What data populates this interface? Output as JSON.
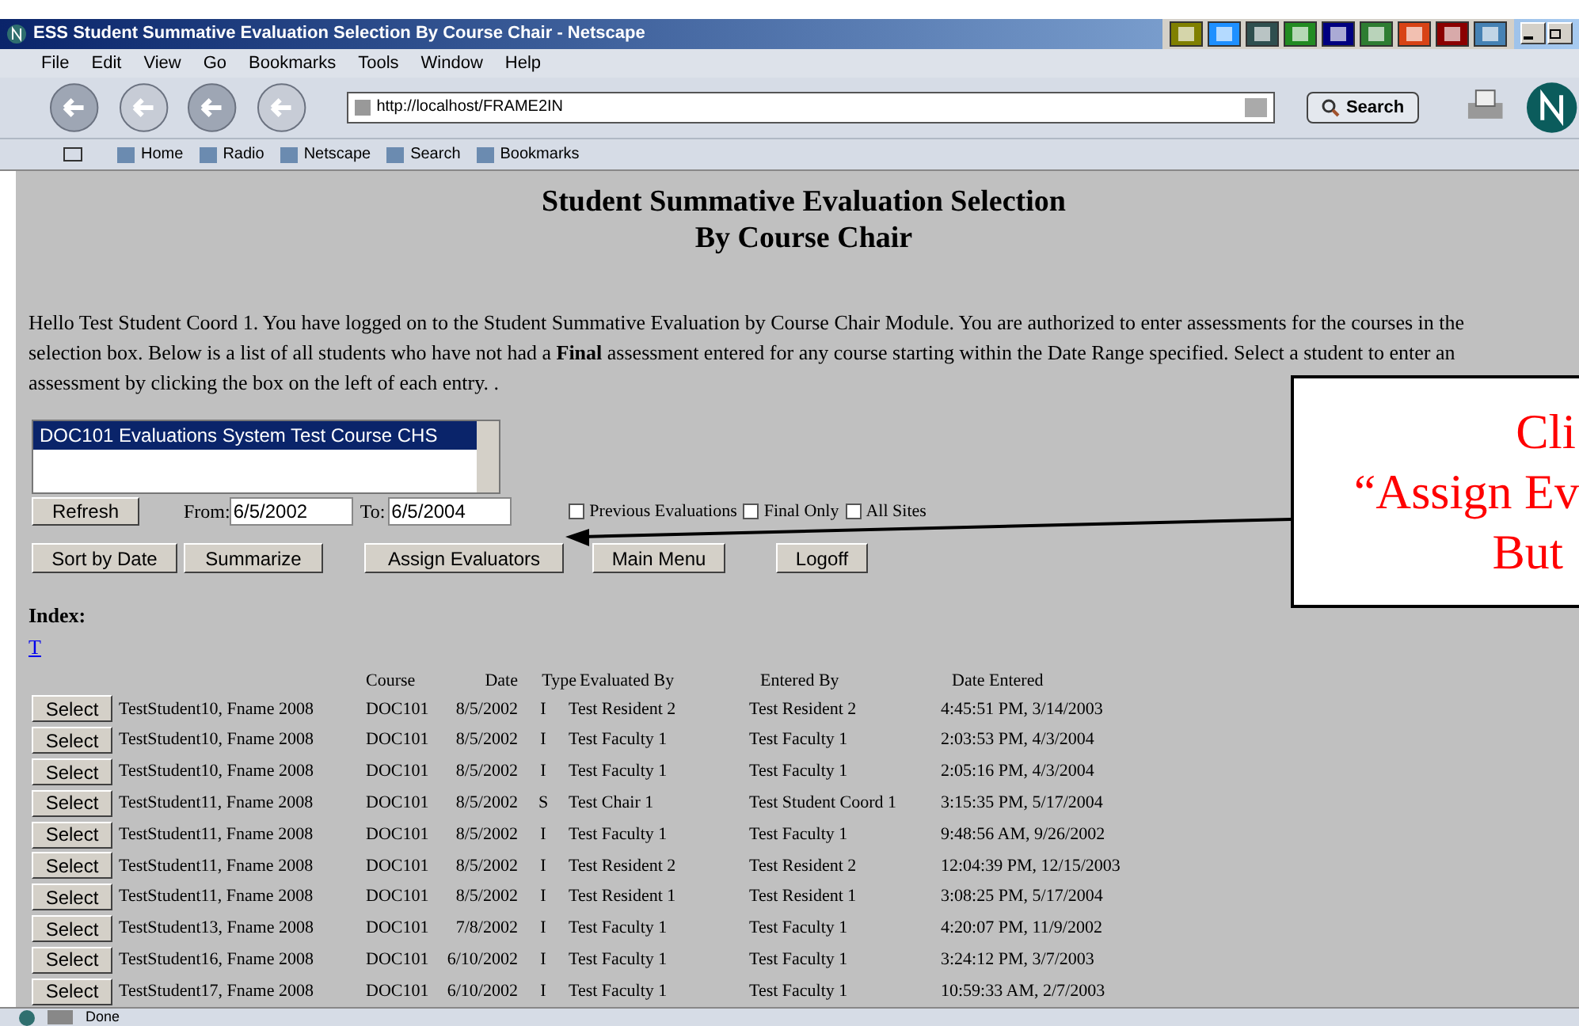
{
  "window": {
    "title": "ESS Student Summative Evaluation Selection By Course Chair - Netscape"
  },
  "menu": [
    "File",
    "Edit",
    "View",
    "Go",
    "Bookmarks",
    "Tools",
    "Window",
    "Help"
  ],
  "address": {
    "value": "http://localhost/FRAME2IN"
  },
  "search_button": "Search",
  "personal_toolbar": [
    "Home",
    "Radio",
    "Netscape",
    "Search",
    "Bookmarks"
  ],
  "heading": [
    "Student Summative Evaluation Selection",
    "By Course Chair"
  ],
  "intro": "Hello Test Student Coord 1. You have logged on to the Student Summative Evaluation by Course Chair Module. You are authorized to enter assessments for the courses in the selection box. Below is a list of all students who have not had a **Final** assessment entered for any course starting within the Date Range specified. Select a student to enter an assessment by clicking the box on the left of each entry. .",
  "course_list": [
    {
      "label": "DOC101 Evaluations System Test Course CHS",
      "selected": true
    }
  ],
  "refresh": "Refresh",
  "from": {
    "label": "From:",
    "value": "6/5/2002"
  },
  "to": {
    "label": "To:",
    "value": "6/5/2004"
  },
  "options": [
    {
      "label": "Previous Evaluations",
      "checked": false
    },
    {
      "label": "Final Only",
      "checked": false
    },
    {
      "label": "All Sites",
      "checked": false
    }
  ],
  "buttons": [
    "Sort by Date",
    "Summarize",
    "Assign Evaluators",
    "Main Menu",
    "Logoff"
  ],
  "index": {
    "label": "Index:",
    "links": [
      "T"
    ]
  },
  "table": {
    "columns": [
      "Course",
      "Date",
      "Type",
      "Evaluated By",
      "Entered By",
      "Date Entered"
    ],
    "rows": [
      {
        "action": "Select",
        "student": "TestStudent10, Fname 2008",
        "cells": [
          "DOC101",
          "8/5/2002",
          "I",
          "Test Resident 2",
          "Test Resident 2",
          "4:45:51 PM, 3/14/2003"
        ]
      },
      {
        "action": "Select",
        "student": "TestStudent10, Fname 2008",
        "cells": [
          "DOC101",
          "8/5/2002",
          "I",
          "Test Faculty 1",
          "Test Faculty 1",
          "2:03:53 PM, 4/3/2004"
        ]
      },
      {
        "action": "Select",
        "student": "TestStudent10, Fname 2008",
        "cells": [
          "DOC101",
          "8/5/2002",
          "I",
          "Test Faculty 1",
          "Test Faculty 1",
          "2:05:16 PM, 4/3/2004"
        ]
      },
      {
        "action": "Select",
        "student": "TestStudent11, Fname 2008",
        "cells": [
          "DOC101",
          "8/5/2002",
          "S",
          "Test Chair 1",
          "Test Student Coord 1",
          "3:15:35 PM, 5/17/2004"
        ]
      },
      {
        "action": "Select",
        "student": "TestStudent11, Fname 2008",
        "cells": [
          "DOC101",
          "8/5/2002",
          "I",
          "Test Faculty 1",
          "Test Faculty 1",
          "9:48:56 AM, 9/26/2002"
        ]
      },
      {
        "action": "Select",
        "student": "TestStudent11, Fname 2008",
        "cells": [
          "DOC101",
          "8/5/2002",
          "I",
          "Test Resident 2",
          "Test Resident 2",
          "12:04:39 PM, 12/15/2003"
        ]
      },
      {
        "action": "Select",
        "student": "TestStudent11, Fname 2008",
        "cells": [
          "DOC101",
          "8/5/2002",
          "I",
          "Test Resident 1",
          "Test Resident 1",
          "3:08:25 PM, 5/17/2004"
        ]
      },
      {
        "action": "Select",
        "student": "TestStudent13, Fname 2008",
        "cells": [
          "DOC101",
          "7/8/2002",
          "I",
          "Test Faculty 1",
          "Test Faculty 1",
          "4:20:07 PM, 11/9/2002"
        ]
      },
      {
        "action": "Select",
        "student": "TestStudent16, Fname 2008",
        "cells": [
          "DOC101",
          "6/10/2002",
          "I",
          "Test Faculty 1",
          "Test Faculty 1",
          "3:24:12 PM, 3/7/2003"
        ]
      },
      {
        "action": "Select",
        "student": "TestStudent17, Fname 2008",
        "cells": [
          "DOC101",
          "6/10/2002",
          "I",
          "Test Faculty 1",
          "Test Faculty 1",
          "10:59:33 AM, 2/7/2003"
        ]
      }
    ]
  },
  "callout": [
    "Cli",
    "“Assign Ev",
    "But"
  ],
  "status": "Done"
}
